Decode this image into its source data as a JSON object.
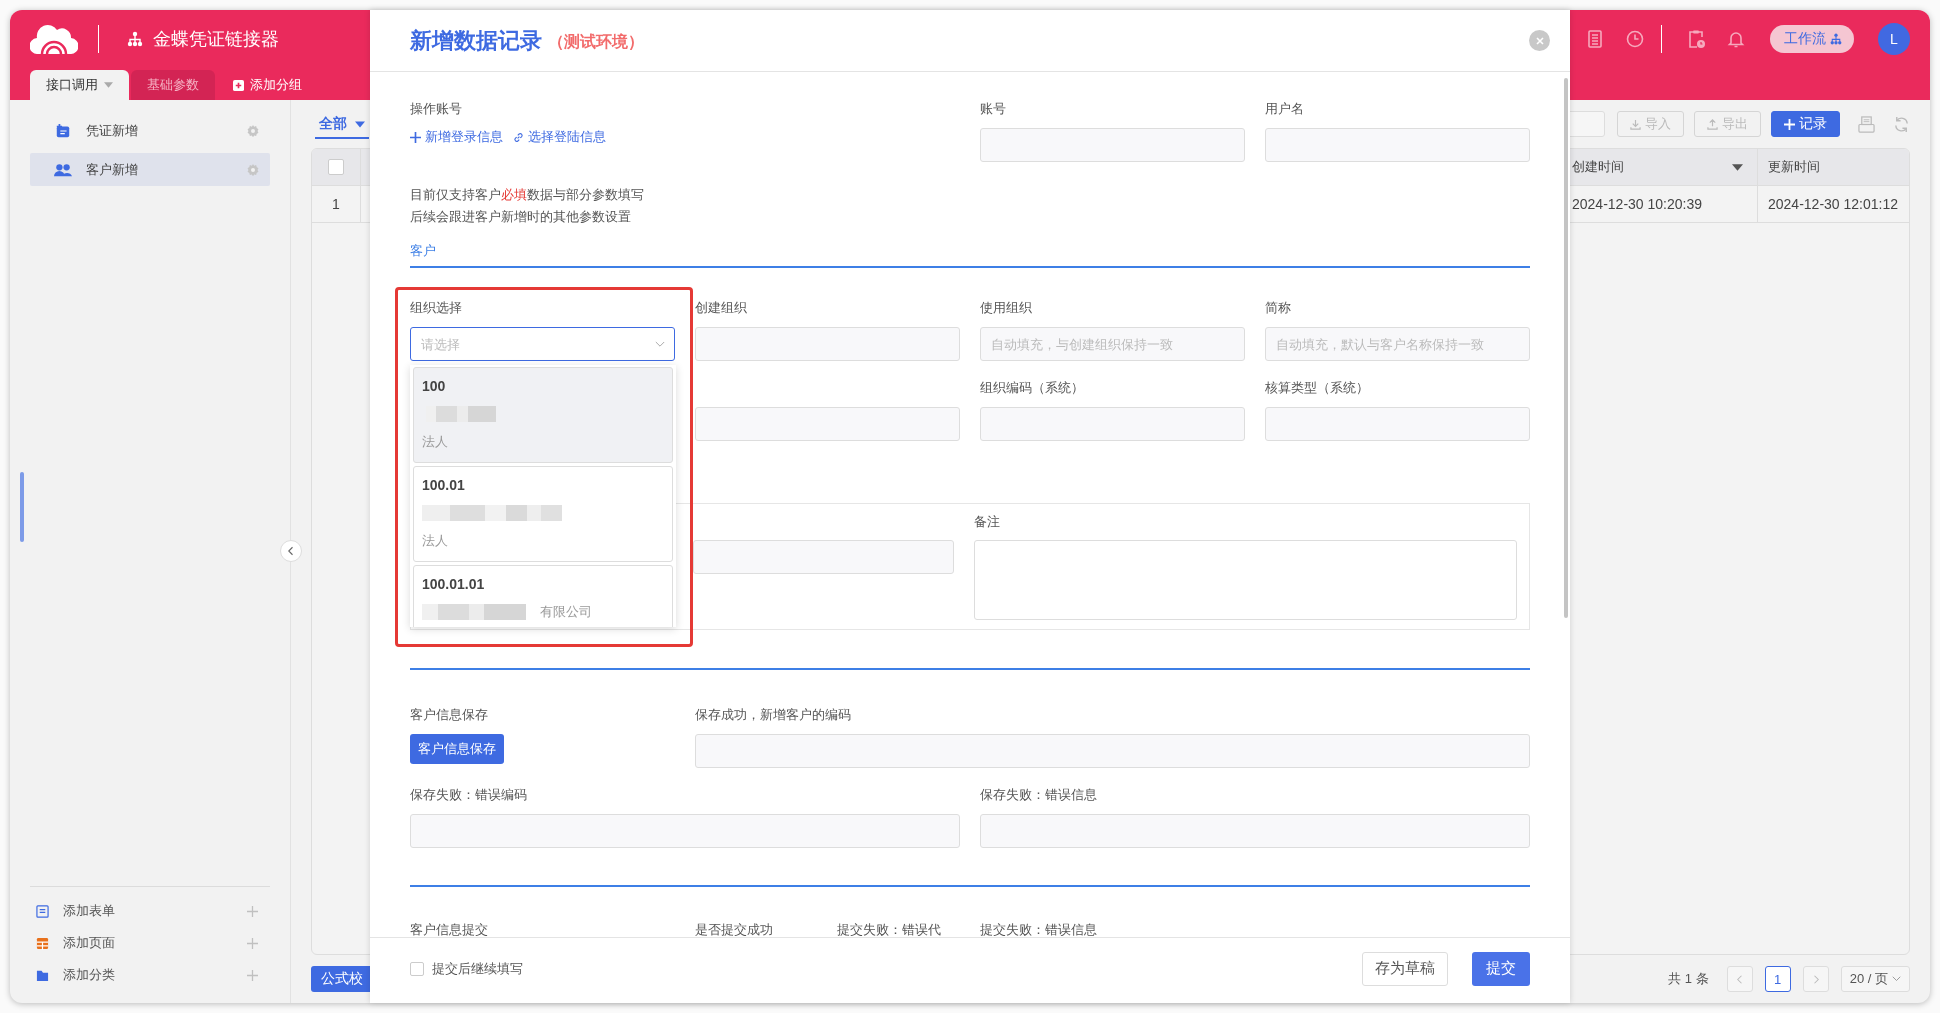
{
  "app": {
    "title": "金蝶凭证链接器",
    "tabs": [
      {
        "label": "接口调用",
        "selected": true,
        "kind": "menu"
      },
      {
        "label": "基础参数",
        "selected": false,
        "kind": "plain"
      },
      {
        "label": "添加分组",
        "selected": false,
        "kind": "add"
      }
    ],
    "workflow": "工作流",
    "avatar": "L"
  },
  "sidebar": {
    "items": [
      {
        "label": "凭证新增",
        "selected": false,
        "kind": "voucher"
      },
      {
        "label": "客户新增",
        "selected": true,
        "kind": "users"
      }
    ],
    "footer_items": [
      {
        "label": "添加表单",
        "kind": "form"
      },
      {
        "label": "添加页面",
        "kind": "page"
      },
      {
        "label": "添加分类",
        "kind": "folder"
      }
    ]
  },
  "main": {
    "filter_tab": "全部",
    "toolbar": [
      {
        "label": "导入",
        "kind": "import"
      },
      {
        "label": "导出",
        "kind": "export"
      },
      {
        "label": "记录",
        "kind": "add"
      }
    ],
    "table": {
      "all_checked": false,
      "columns": [
        "创建时间",
        "更新时间"
      ],
      "rows": [
        {
          "index": "1",
          "cells": [
            "2024-12-30 10:20:39",
            "2024-12-30 12:01:12"
          ]
        }
      ]
    },
    "formula_button": "公式校",
    "pagination": {
      "total": "共 1 条",
      "pages": [
        {
          "label": "1",
          "selected": true
        }
      ],
      "page_size": "20 / 页"
    }
  },
  "modal": {
    "title": "新增数据记录",
    "env": "（测试环境）",
    "account": {
      "label": "操作账号",
      "links": [
        {
          "label": "新增登录信息",
          "kind": "add"
        },
        {
          "label": "选择登陆信息",
          "kind": "select"
        }
      ],
      "fields": [
        {
          "label": "账号"
        },
        {
          "label": "用户名"
        }
      ]
    },
    "notes": [
      {
        "parts": [
          {
            "text": "目前仅支持客户",
            "kind": "plain"
          },
          {
            "text": "必填",
            "kind": "required"
          },
          {
            "text": "数据与部分参数填写",
            "kind": "plain"
          }
        ]
      },
      {
        "parts": [
          {
            "text": "后续会跟进客户新增时的其他参数设置",
            "kind": "plain"
          }
        ]
      }
    ],
    "section": "客户",
    "row1": [
      {
        "label": "组织选择",
        "kind": "select",
        "placeholder": "请选择",
        "focused": true
      },
      {
        "label": "创建组织",
        "kind": "input"
      },
      {
        "label": "使用组织",
        "kind": "input",
        "placeholder": "自动填充，与创建组织保持一致"
      },
      {
        "label": "简称",
        "kind": "input",
        "placeholder": "自动填充，默认与客户名称保持一致"
      }
    ],
    "row2": [
      {
        "kind": "blank"
      },
      {
        "kind": "input"
      },
      {
        "label": "组织编码（系统）",
        "kind": "input"
      },
      {
        "label": "核算类型（系统）",
        "kind": "input"
      }
    ],
    "box": [
      {
        "kind": "blank"
      },
      {
        "kind": "input"
      },
      {
        "label": "备注",
        "kind": "textarea"
      }
    ],
    "save": {
      "label": "客户信息保存",
      "button": "客户信息保存",
      "result": "保存成功，新增客户的编码",
      "errors": [
        "保存失败：错误编码",
        "保存失败：错误信息"
      ]
    },
    "submit_labels": [
      "客户信息提交",
      "是否提交成功",
      "提交失败：错误代",
      "提交失败：错误信息"
    ],
    "footer": {
      "continue": {
        "label": "提交后继续填写",
        "checked": false
      },
      "draft": "存为草稿",
      "submit": "提交"
    },
    "dropdown": [
      {
        "code": "100",
        "type": "法人",
        "selected": true
      },
      {
        "code": "100.01",
        "type": "法人",
        "selected": false
      },
      {
        "code": "100.01.01",
        "suffix": "有限公司",
        "selected": false
      }
    ]
  }
}
